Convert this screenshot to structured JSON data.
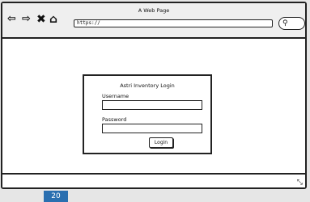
{
  "window": {
    "title": "A Web Page"
  },
  "nav": {
    "back": "⇦",
    "forward": "⇨",
    "close": "✖",
    "home": "⌂"
  },
  "address_bar": {
    "value": "https://"
  },
  "search": {
    "icon": "search-icon",
    "glyph": "⚲"
  },
  "login": {
    "title": "Astri Inventory Login",
    "username_label": "Username",
    "password_label": "Password",
    "username_value": "",
    "password_value": "",
    "button_label": "Login"
  },
  "status": {
    "resize_glyph": "⤡"
  },
  "badge": {
    "text": "20"
  }
}
